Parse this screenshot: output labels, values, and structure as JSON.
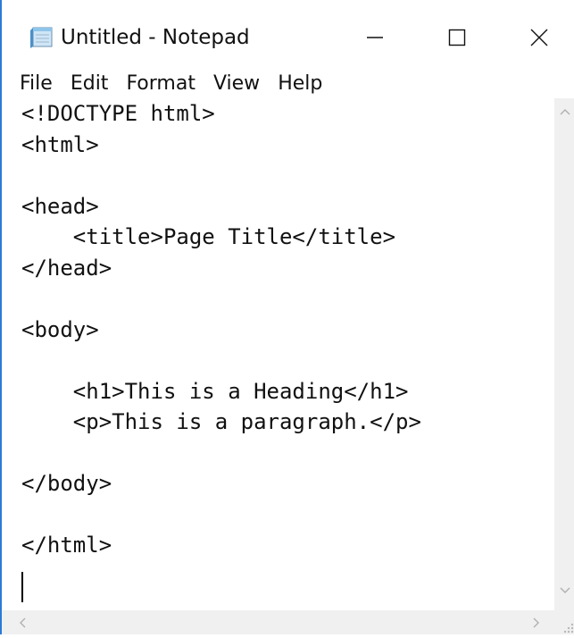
{
  "window": {
    "title": "Untitled - Notepad",
    "accent_color": "#2b7bd8",
    "controls": {
      "minimize_icon": "minimize-icon",
      "maximize_icon": "maximize-icon",
      "close_icon": "close-icon"
    }
  },
  "menu": {
    "items": [
      "File",
      "Edit",
      "Format",
      "View",
      "Help"
    ]
  },
  "editor": {
    "content": "<!DOCTYPE html>\n<html>\n\n<head>\n    <title>Page Title</title>\n</head>\n\n<body>\n\n    <h1>This is a Heading</h1>\n    <p>This is a paragraph.</p>\n\n</body>\n\n</html>"
  }
}
